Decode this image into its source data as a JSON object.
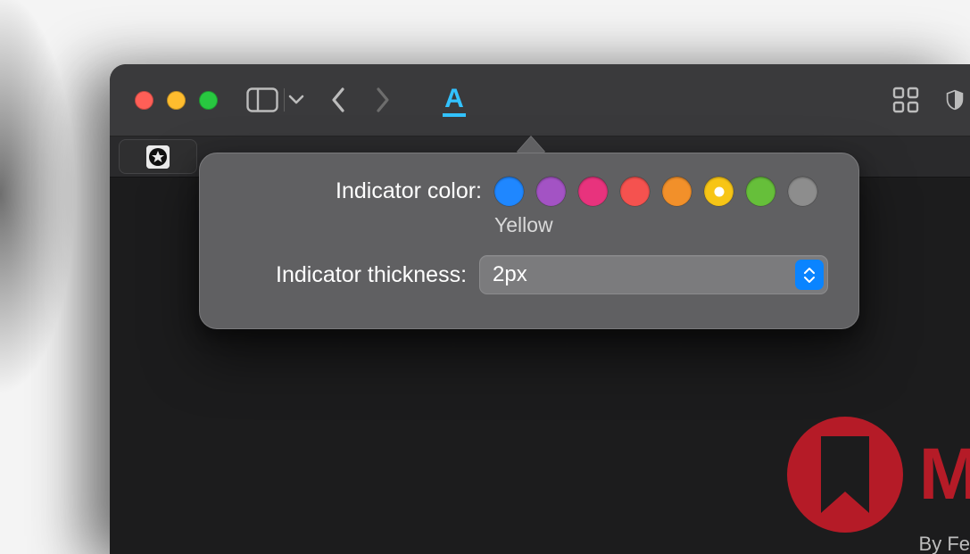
{
  "toolbar": {
    "active_tool_glyph": "A"
  },
  "popover": {
    "color_label": "Indicator color:",
    "thickness_label": "Indicator thickness:",
    "selected_color_name": "Yellow",
    "thickness_value": "2px",
    "colors": [
      {
        "name": "Blue",
        "hex": "#1f87ff"
      },
      {
        "name": "Purple",
        "hex": "#a353c4"
      },
      {
        "name": "Pink",
        "hex": "#e8337d"
      },
      {
        "name": "Red",
        "hex": "#f5524f"
      },
      {
        "name": "Orange",
        "hex": "#f2902a"
      },
      {
        "name": "Yellow",
        "hex": "#f7c516",
        "selected": true
      },
      {
        "name": "Green",
        "hex": "#66bf3a"
      },
      {
        "name": "Graphite",
        "hex": "#8d8d8d"
      }
    ]
  },
  "brand": {
    "initial": "M",
    "byline_prefix": "By Fe"
  }
}
